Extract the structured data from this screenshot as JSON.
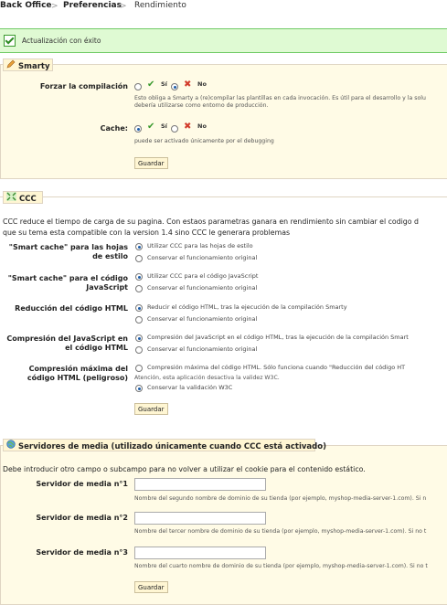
{
  "breadcrumb": {
    "items": [
      "Back Office",
      "Preferencias",
      "Rendimiento"
    ]
  },
  "success": {
    "message": "Actualización con éxito"
  },
  "smarty": {
    "title": "Smarty",
    "force_compile": {
      "label": "Forzar la compilación",
      "yes": "Sí",
      "no": "No",
      "selected": "yes",
      "hint_line1": "Esto obliga a Smarty a (re)compilar las plantillas en cada invocación. Es útil para el desarrollo y la solu",
      "hint_line2": "debería utilizarse como entorno de producción."
    },
    "cache": {
      "label": "Cache:",
      "yes": "Sí",
      "no": "No",
      "selected": "yes",
      "hint": "puede ser activado únicamente por el debugging"
    },
    "save_label": "Guardar"
  },
  "ccc": {
    "title": "CCC",
    "desc_line1": "CCC reduce el tiempo de carga de su pagina. Con estaos parametras ganara en rendimiento sin cambiar el codigo d",
    "desc_line2": "que su tema esta compatible con la version 1.4 sino CCC le generara problemas",
    "options": [
      {
        "label": "\"Smart cache\" para las hojas de estilo",
        "opt1": "Utilizar CCC para las hojas de estilo",
        "opt2": "Conservar el funcionamiento original",
        "selected": 1
      },
      {
        "label": "\"Smart cache\" para el código JavaScript",
        "opt1": "Utilizar CCC para el código JavaScript",
        "opt2": "Conservar el funcionamiento original",
        "selected": 1
      },
      {
        "label": "Reducción del código HTML",
        "opt1": "Reducir el código HTML, tras la ejecución de la compilación Smarty",
        "opt2": "Conservar el funcionamiento original",
        "selected": 1
      },
      {
        "label": "Compresión del JavaScript en el código HTML",
        "opt1": "Compresión del JavaScript en el código HTML, tras la ejecución de la compilación Smart",
        "opt2": "Conservar el funcionamiento original",
        "selected": 1
      },
      {
        "label": "Compresión máxima del código HTML (peligroso)",
        "opt1": "Compresión máxima del código HTML. Sólo funciona cuando \"Reducción del código HT",
        "opt1_note": "Atención, esta aplicación desactiva la validez W3C.",
        "opt2": "Conservar la validación W3C",
        "selected": 2
      }
    ],
    "save_label": "Guardar"
  },
  "media": {
    "title": "Servidores de media (utilizado únicamente cuando CCC está activado)",
    "desc": "Debe introducir otro campo o subcampo para no volver a utilizar el cookie para el contenido estático.",
    "servers": [
      {
        "label": "Servidor de media n°1",
        "value": "",
        "hint": "Nombre del segundo nombre de dominio de su tienda (por ejemplo, myshop-media-server-1.com). Si n"
      },
      {
        "label": "Servidor de media n°2",
        "value": "",
        "hint": "Nombre del tercer nombre de dominio de su tienda (por ejemplo, myshop-media-server-1.com). Si no t"
      },
      {
        "label": "Servidor de media n°3",
        "value": "",
        "hint": "Nombre del cuarto nombre de dominio de su tienda (por ejemplo, myshop-media-server-1.com). Si no t"
      }
    ],
    "save_label": "Guardar"
  }
}
